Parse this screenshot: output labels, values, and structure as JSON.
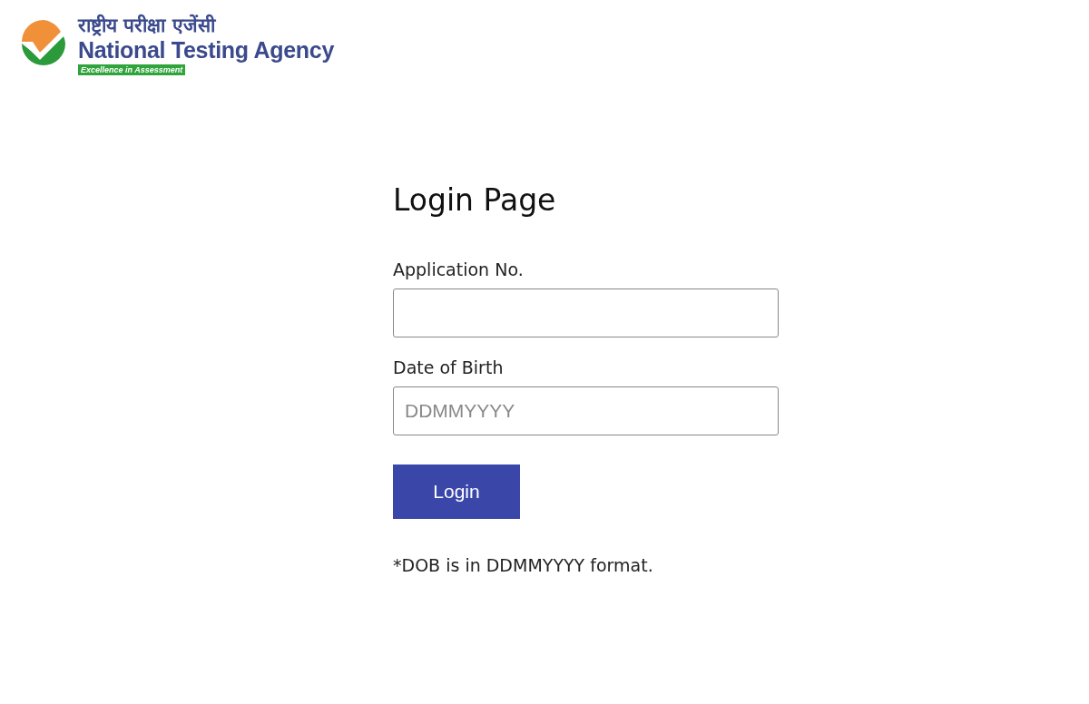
{
  "header": {
    "hindi_name": "राष्ट्रीय परीक्षा एजेंसी",
    "name": "National Testing Agency",
    "tagline": "Excellence in Assessment"
  },
  "form": {
    "title": "Login Page",
    "fields": [
      {
        "label": "Application No."
      },
      {
        "label": "Date of Birth",
        "placeholder": "DDMMYYYY"
      }
    ],
    "button": "Login",
    "note": "*DOB is in DDMMYYYY format."
  }
}
